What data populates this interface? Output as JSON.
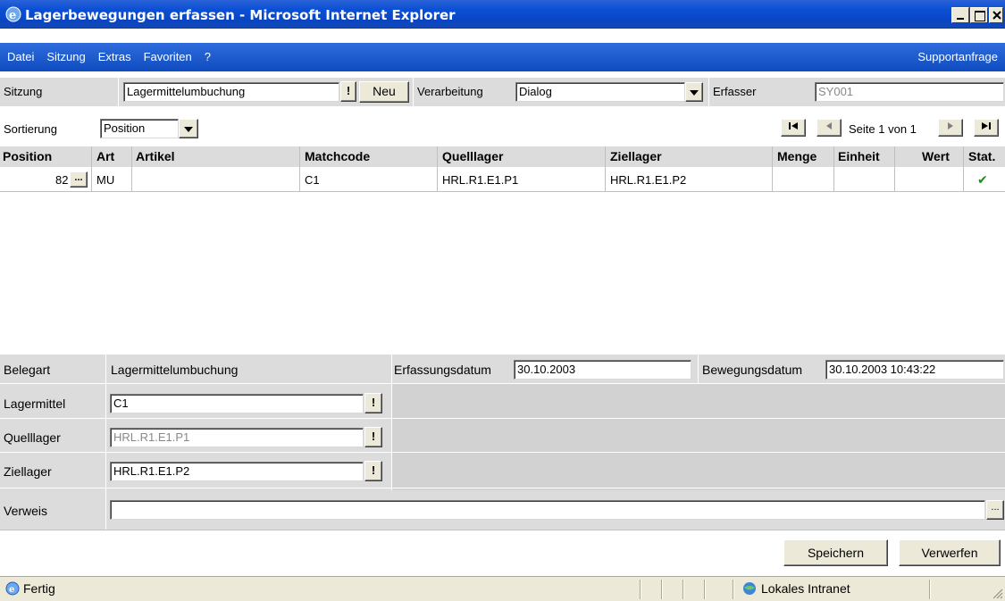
{
  "window": {
    "title": "Lagerbewegungen erfassen - Microsoft Internet Explorer"
  },
  "menu": {
    "items": [
      "Datei",
      "Sitzung",
      "Extras",
      "Favoriten",
      "?"
    ],
    "support": "Supportanfrage"
  },
  "session": {
    "label": "Sitzung",
    "value": "Lagermittelumbuchung",
    "lookup_label": "!",
    "new_label": "Neu",
    "processing_label": "Verarbeitung",
    "processing_value": "Dialog",
    "recorder_label": "Erfasser",
    "recorder_value": "SY001"
  },
  "sorting": {
    "label": "Sortierung",
    "value": "Position",
    "page_text": "Seite 1 von 1"
  },
  "table": {
    "headers": [
      "Position",
      "Art",
      "Artikel",
      "Matchcode",
      "Quelllager",
      "Ziellager",
      "Menge",
      "Einheit",
      "Wert",
      "Stat."
    ],
    "rows": [
      {
        "position": "82",
        "more": "...",
        "art": "MU",
        "artikel": "",
        "matchcode": "C1",
        "quelllager": "HRL.R1.E1.P1",
        "ziellager": "HRL.R1.E1.P2",
        "menge": "",
        "einheit": "",
        "wert": "",
        "status": "✔"
      }
    ]
  },
  "details": {
    "belegart_label": "Belegart",
    "belegart_value": "Lagermittelumbuchung",
    "erfassungsdatum_label": "Erfassungsdatum",
    "erfassungsdatum_value": "30.10.2003",
    "bewegungsdatum_label": "Bewegungsdatum",
    "bewegungsdatum_value": "30.10.2003 10:43:22",
    "lagermittel_label": "Lagermittel",
    "lagermittel_value": "C1",
    "quelllager_label": "Quelllager",
    "quelllager_value": "HRL.R1.E1.P1",
    "ziellager_label": "Ziellager",
    "ziellager_value": "HRL.R1.E1.P2",
    "verweis_label": "Verweis",
    "verweis_value": "",
    "lookup_label": "!",
    "dots_label": "..."
  },
  "actions": {
    "save": "Speichern",
    "discard": "Verwerfen"
  },
  "status": {
    "text": "Fertig",
    "zone": "Lokales Intranet"
  },
  "colors": {
    "titlebar": "#0a4fd4",
    "panel": "#dcdcdc",
    "check": "#1a8f1a"
  }
}
